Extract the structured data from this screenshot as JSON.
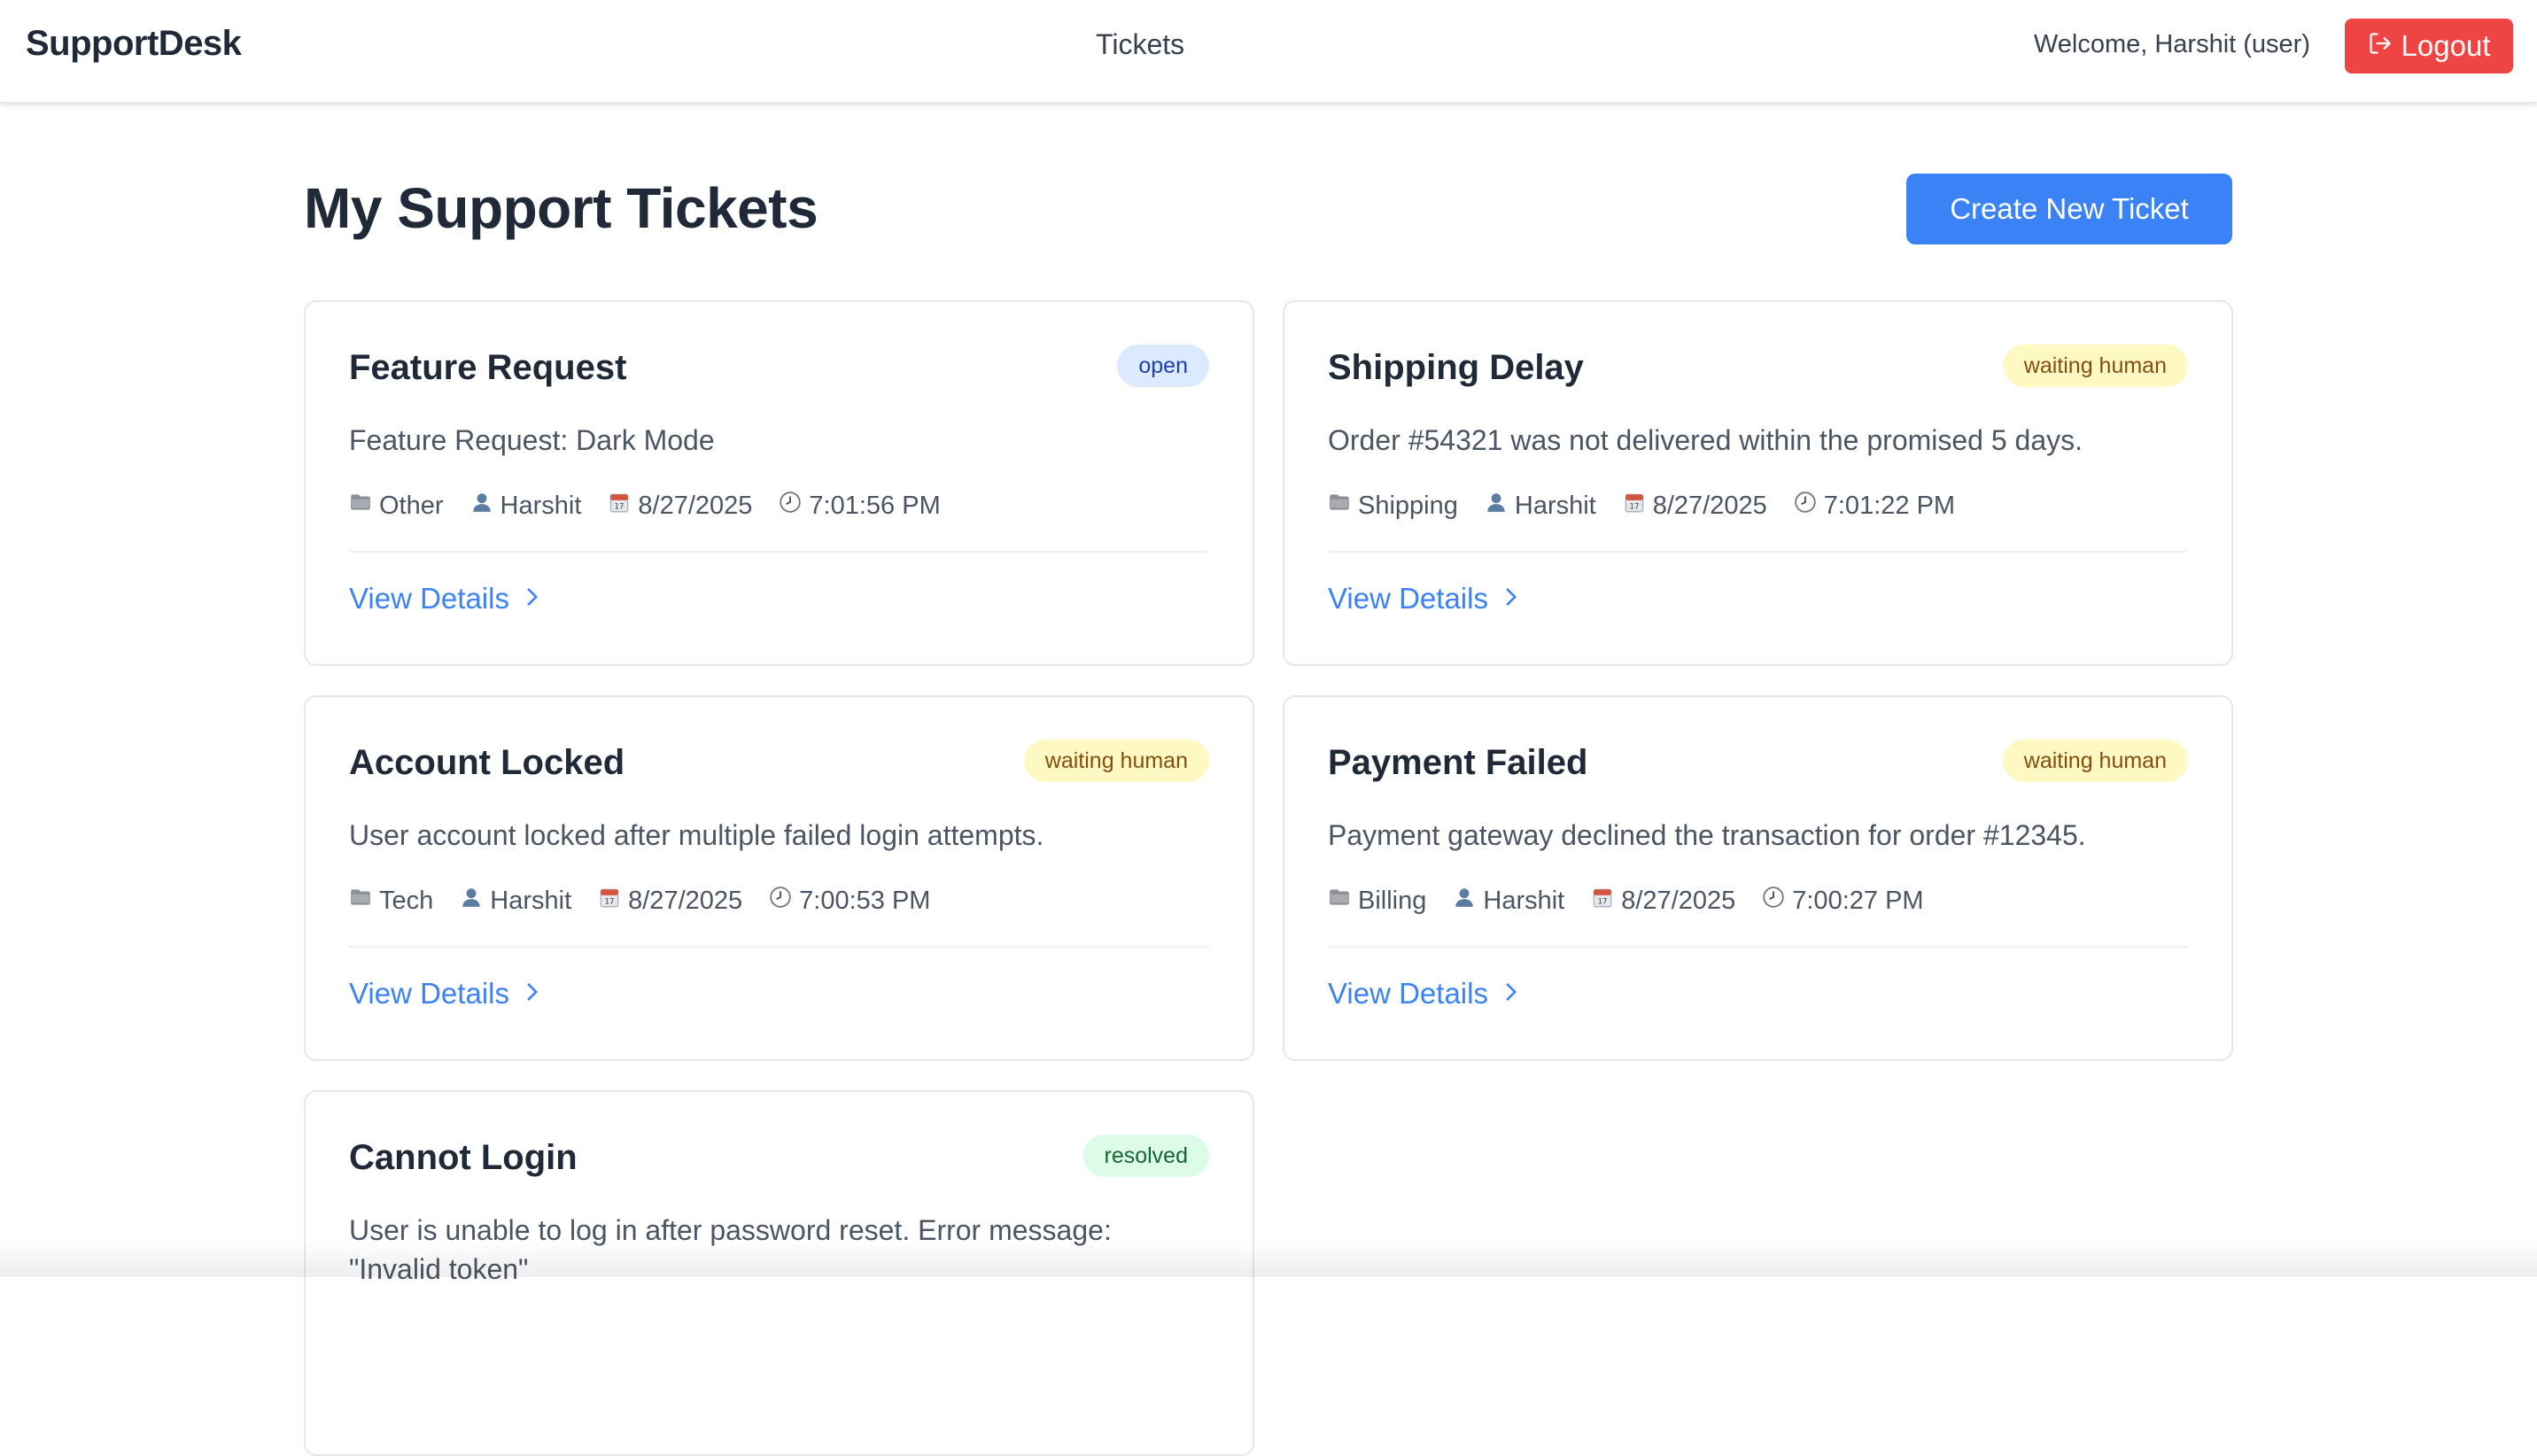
{
  "header": {
    "brand": "SupportDesk",
    "nav_link": "Tickets",
    "welcome": "Welcome, Harshit (user)",
    "logout_label": "Logout",
    "logout_color": "#ef4444"
  },
  "main": {
    "title": "My Support Tickets",
    "create_label": "Create New Ticket",
    "accent": "#3b82f6"
  },
  "tickets": [
    {
      "title": "Feature Request",
      "status": "open",
      "description": "Feature Request: Dark Mode",
      "category": "Other",
      "user": "Harshit",
      "date": "8/27/2025",
      "time": "7:01:56 PM",
      "link": "View Details"
    },
    {
      "title": "Shipping Delay",
      "status": "waiting human",
      "description": "Order #54321 was not delivered within the promised 5 days.",
      "category": "Shipping",
      "user": "Harshit",
      "date": "8/27/2025",
      "time": "7:01:22 PM",
      "link": "View Details"
    },
    {
      "title": "Account Locked",
      "status": "waiting human",
      "description": "User account locked after multiple failed login attempts.",
      "category": "Tech",
      "user": "Harshit",
      "date": "8/27/2025",
      "time": "7:00:53 PM",
      "link": "View Details"
    },
    {
      "title": "Payment Failed",
      "status": "waiting human",
      "description": "Payment gateway declined the transaction for order #12345.",
      "category": "Billing",
      "user": "Harshit",
      "date": "8/27/2025",
      "time": "7:00:27 PM",
      "link": "View Details"
    },
    {
      "title": "Cannot Login",
      "status": "resolved",
      "description": "User is unable to log in after password reset. Error message: \"Invalid token\""
    }
  ],
  "icons": {
    "category": "folder-icon",
    "user": "user-icon",
    "date": "calendar-icon",
    "time": "clock-icon",
    "logout": "logout-icon",
    "link": "chevron-right-icon"
  }
}
